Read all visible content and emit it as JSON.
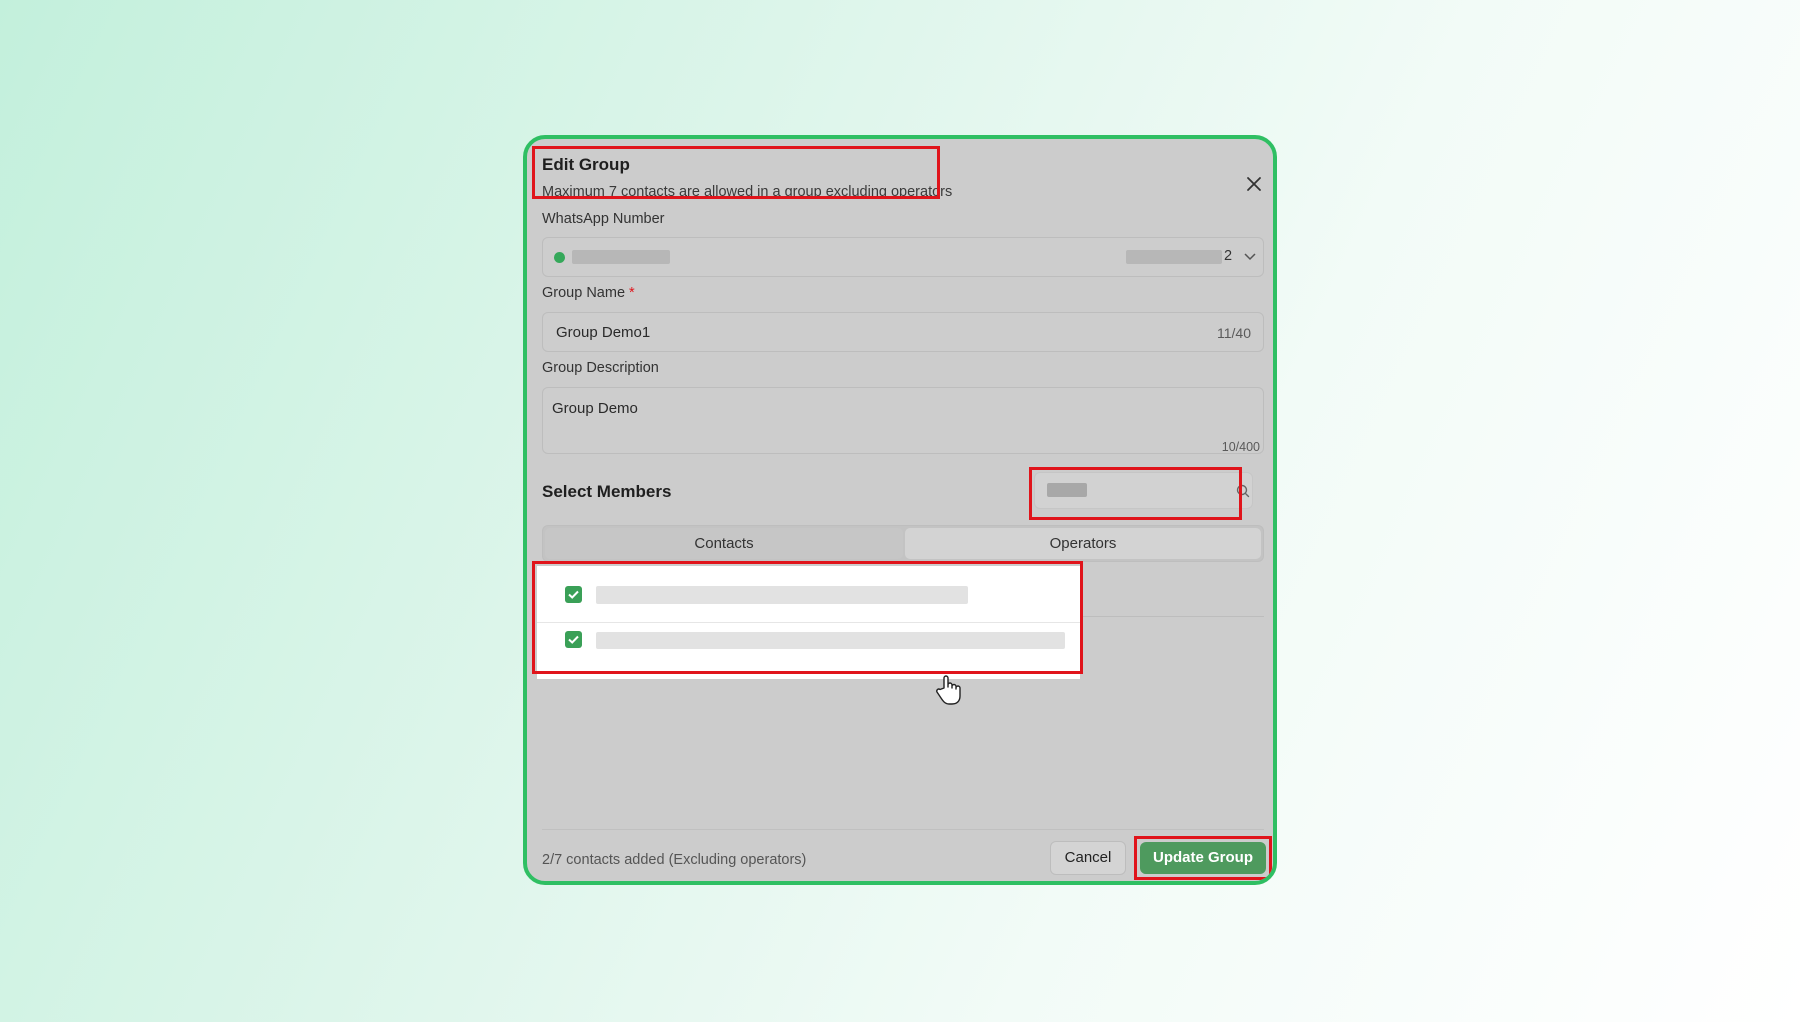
{
  "dialog": {
    "title": "Edit Group",
    "subtitle": "Maximum 7 contacts are allowed in a group excluding operators"
  },
  "whatsapp": {
    "label": "WhatsApp Number",
    "selected_suffix": "2"
  },
  "group_name": {
    "label": "Group Name",
    "required_mark": "*",
    "value": "Group Demo1",
    "counter": "11/40"
  },
  "group_description": {
    "label": "Group Description",
    "value": "Group Demo",
    "counter": "10/400"
  },
  "members": {
    "title": "Select Members",
    "tabs": [
      {
        "label": "Contacts",
        "active": true
      },
      {
        "label": "Operators",
        "active": false
      }
    ],
    "rows": [
      {
        "checked": true
      },
      {
        "checked": true
      }
    ]
  },
  "footer": {
    "status": "2/7 contacts added (Excluding operators)",
    "cancel_label": "Cancel",
    "update_label": "Update Group"
  },
  "colors": {
    "accent": "#4e9a5e",
    "border_green": "#2fbf63",
    "highlight": "#e0141b"
  }
}
